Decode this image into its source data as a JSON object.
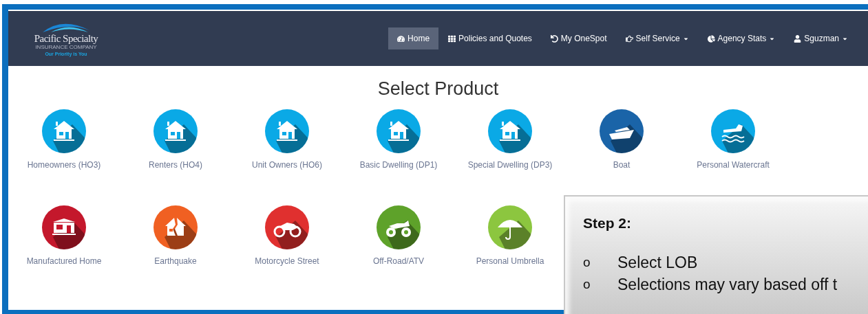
{
  "logo": {
    "name": "Pacific Specialty",
    "subtitle": "INSURANCE COMPANY",
    "tagline": "Our Priority is You"
  },
  "nav": [
    {
      "label": "Home",
      "selected": true,
      "dropdown": false
    },
    {
      "label": "Policies and Quotes",
      "selected": false,
      "dropdown": false
    },
    {
      "label": "My OneSpot",
      "selected": false,
      "dropdown": false
    },
    {
      "label": "Self Service",
      "selected": false,
      "dropdown": true
    },
    {
      "label": "Agency Stats",
      "selected": false,
      "dropdown": true
    },
    {
      "label": "Sguzman",
      "selected": false,
      "dropdown": true
    }
  ],
  "title": "Select Product",
  "product_rows": [
    [
      {
        "label": "Homeowners (HO3)",
        "kind": "house",
        "color": "#0aa9e6"
      },
      {
        "label": "Renters (HO4)",
        "kind": "house",
        "color": "#0aa9e6"
      },
      {
        "label": "Unit Owners (HO6)",
        "kind": "house",
        "color": "#0aa9e6"
      },
      {
        "label": "Basic Dwelling (DP1)",
        "kind": "house",
        "color": "#0aa9e6"
      },
      {
        "label": "Special Dwelling (DP3)",
        "kind": "house",
        "color": "#0aa9e6"
      },
      {
        "label": "Boat",
        "kind": "boat",
        "color": "#1a64a8"
      },
      {
        "label": "Personal Watercraft",
        "kind": "watercraft",
        "color": "#0aa9e6"
      }
    ],
    [
      {
        "label": "Manufactured Home",
        "kind": "manufactured",
        "color": "#c4182c"
      },
      {
        "label": "Earthquake",
        "kind": "earthquake",
        "color": "#f06022"
      },
      {
        "label": "Motorcycle Street",
        "kind": "motorcycle",
        "color": "#e0302f"
      },
      {
        "label": "Off-Road/ATV",
        "kind": "atv",
        "color": "#5ea22a"
      },
      {
        "label": "Personal Umbrella",
        "kind": "umbrella",
        "color": "#8cc63f"
      }
    ]
  ],
  "callout": {
    "heading": "Step 2:",
    "bullets": [
      {
        "marker": "o",
        "text": "Select LOB"
      },
      {
        "marker": "o",
        "text": "Selections may vary based off t"
      }
    ]
  }
}
